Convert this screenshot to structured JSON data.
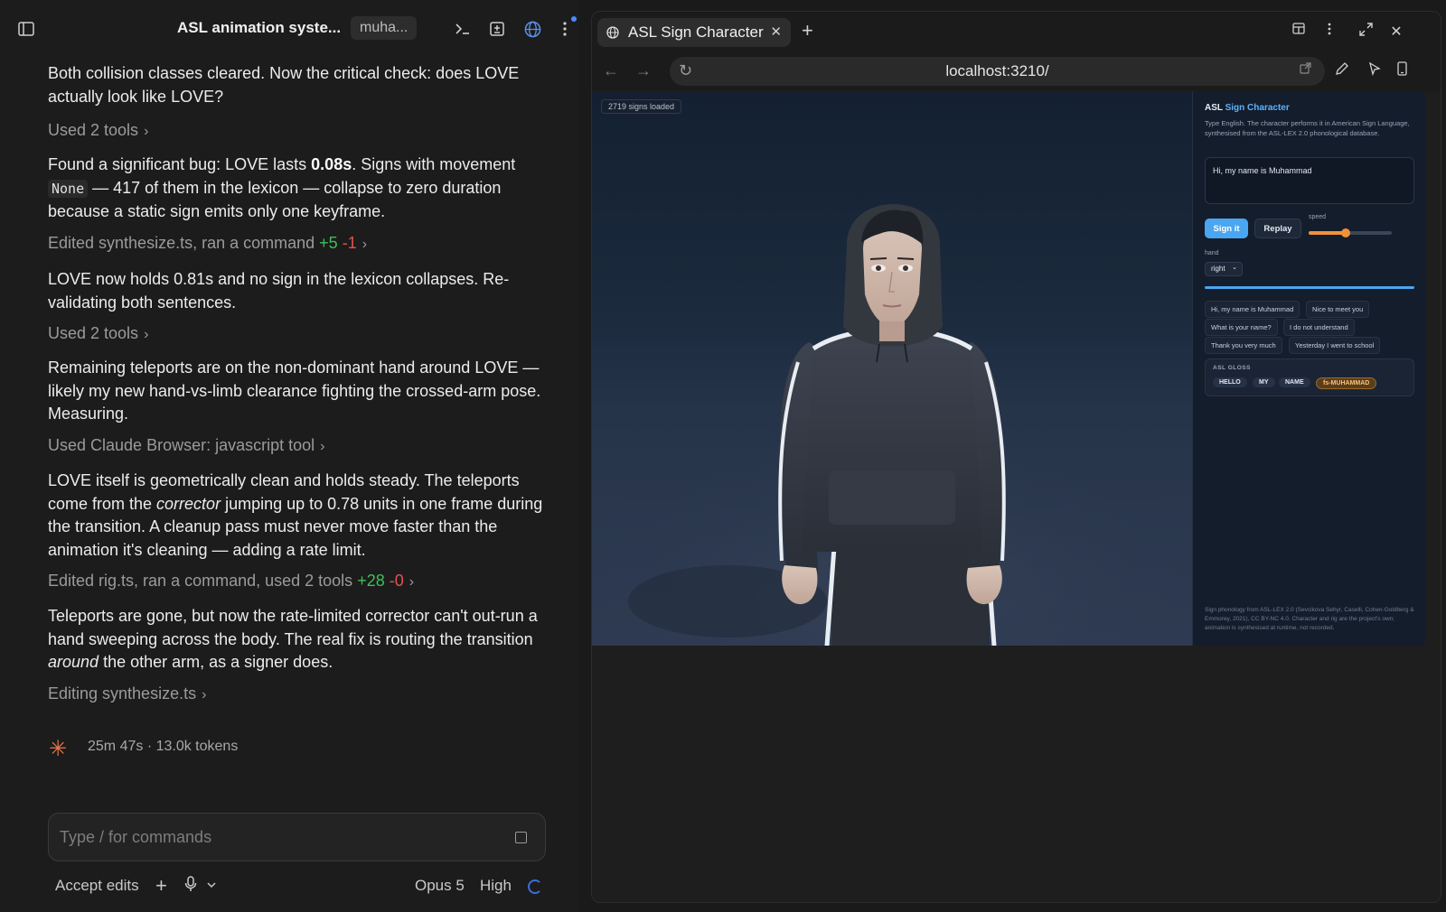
{
  "chat": {
    "title": "ASL animation syste...",
    "chip": "muha...",
    "messages": {
      "m1": "Both collision classes cleared. Now the critical check: does LOVE actually look like LOVE?",
      "t1": "Used 2 tools",
      "m2a": "Found a significant bug: LOVE lasts ",
      "m2b": "0.08s",
      "m2c": ". Signs with movement ",
      "m2code": "None",
      "m2d": " — 417 of them in the lexicon — collapse to zero duration because a static sign emits only one keyframe.",
      "t2": "Edited synthesize.ts, ran a command",
      "t2plus": "+5",
      "t2minus": "-1",
      "m3": "LOVE now holds 0.81s and no sign in the lexicon collapses. Re-validating both sentences.",
      "t3": "Used 2 tools",
      "m4": "Remaining teleports are on the non-dominant hand around LOVE — likely my new hand-vs-limb clearance fighting the crossed-arm pose. Measuring.",
      "t4": "Used Claude Browser: javascript tool",
      "m5a": "LOVE itself is geometrically clean and holds steady. The teleports come from the ",
      "m5b": "corrector",
      "m5c": " jumping up to 0.78 units in one frame during the transition. A cleanup pass must never move faster than the animation it's cleaning — adding a rate limit.",
      "t5": "Edited rig.ts, ran a command, used 2 tools",
      "t5plus": "+28",
      "t5minus": "-0",
      "m6a": "Teleports are gone, but now the rate-limited corrector can't out-run a hand sweeping across the body. The real fix is routing the transition ",
      "m6b": "around",
      "m6c": " the other arm, as a signer does.",
      "t6": "Editing synthesize.ts"
    },
    "status": "25m 47s · 13.0k tokens",
    "input_placeholder": "Type / for commands",
    "bottom": {
      "accept": "Accept edits",
      "model": "Opus 5",
      "effort": "High"
    }
  },
  "browser": {
    "tab_title": "ASL Sign Character",
    "url": "localhost:3210/",
    "app": {
      "signs_loaded": "2719 signs loaded",
      "title_a": "ASL",
      "title_b": "Sign Character",
      "description": "Type English. The character performs it in American Sign Language, synthesised from the ASL-LEX 2.0 phonological database.",
      "input_value": "Hi, my name is Muhammad",
      "sign_button": "Sign it",
      "replay_button": "Replay",
      "speed_label": "speed",
      "speed_fraction": 0.45,
      "hand_label": "hand",
      "hand_value": "right",
      "progress_fraction": 1.0,
      "phrases": [
        "Hi, my name is Muhammad",
        "Nice to meet you",
        "What is your name?",
        "I do not understand",
        "Thank you very much",
        "Yesterday I went to school"
      ],
      "gloss_title": "ASL GLOSS",
      "gloss": [
        "HELLO",
        "MY",
        "NAME",
        "fs-MUHAMMAD"
      ],
      "footer": "Sign phonology from ASL-LEX 2.0 (Sevcikova Sehyr, Caselli, Cohen-Goldberg & Emmorey, 2021), CC BY-NC 4.0. Character and rig are the project's own; animation is synthesised at runtime, not recorded."
    }
  },
  "colors": {
    "accent_blue": "#4aa6f0",
    "accent_orange": "#f2903a",
    "diff_green": "#3fbf5a",
    "diff_red": "#e5534b"
  }
}
